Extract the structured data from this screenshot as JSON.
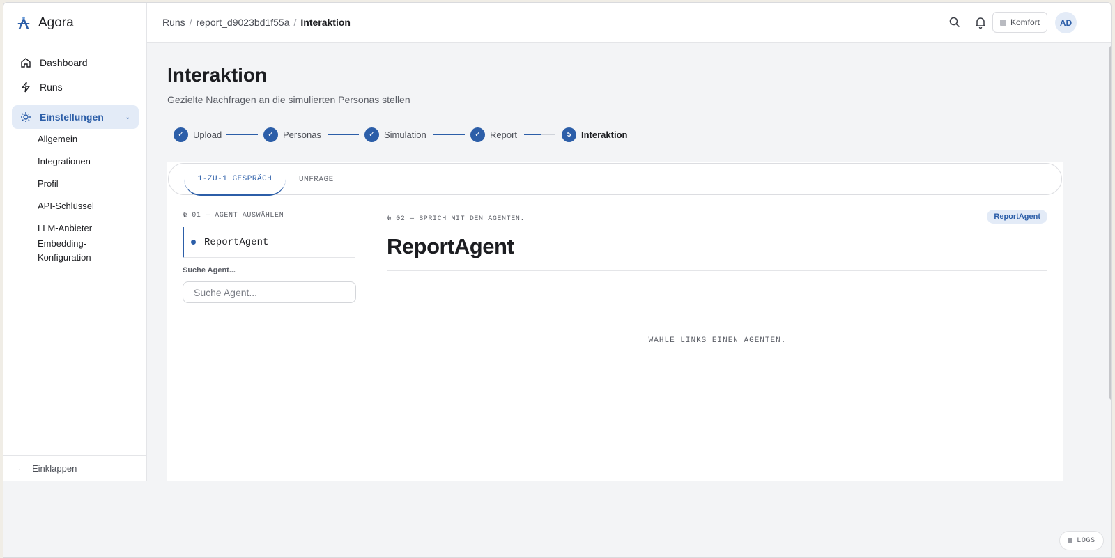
{
  "app": {
    "name": "Agora",
    "brand_color": "#2c5ea8"
  },
  "sidebar": {
    "items": [
      {
        "label": "Dashboard",
        "icon": "home-icon"
      },
      {
        "label": "Runs",
        "icon": "bolt-icon"
      },
      {
        "label": "Einstellungen",
        "icon": "sun-gear-icon",
        "active": true
      }
    ],
    "subitems": [
      {
        "label": "Allgemein"
      },
      {
        "label": "Integrationen"
      },
      {
        "label": "Profil"
      },
      {
        "label": "API-Schlüssel"
      },
      {
        "label": "LLM-Anbieter"
      },
      {
        "label": "Embedding-Konfiguration"
      }
    ],
    "collapse_label": "Einklappen"
  },
  "topbar": {
    "breadcrumb": [
      "Runs",
      "report_d9023bd1f55a",
      "Interaktion"
    ],
    "comfort_label": "Komfort",
    "avatar_initials": "AD"
  },
  "page": {
    "title": "Interaktion",
    "subtitle": "Gezielte Nachfragen an die simulierten Personas stellen"
  },
  "stepper": {
    "steps": [
      {
        "label": "Upload",
        "done": true
      },
      {
        "label": "Personas",
        "done": true
      },
      {
        "label": "Simulation",
        "done": true
      },
      {
        "label": "Report",
        "done": true
      },
      {
        "label": "Interaktion",
        "number": "5",
        "current": true
      }
    ]
  },
  "tabs": [
    {
      "label": "1-ZU-1 GESPRÄCH",
      "active": true
    },
    {
      "label": "UMFRAGE",
      "active": false
    }
  ],
  "left": {
    "section_label": "№ 01 — AGENT AUSWÄHLEN",
    "agent_name": "ReportAgent",
    "search_label": "Suche Agent...",
    "search_placeholder": "Suche Agent..."
  },
  "right": {
    "section_label": "№ 02 — SPRICH MIT DEN AGENTEN.",
    "badge": "ReportAgent",
    "title": "ReportAgent",
    "empty_message": "WÄHLE LINKS EINEN AGENTEN."
  },
  "logs_label": "LOGS"
}
